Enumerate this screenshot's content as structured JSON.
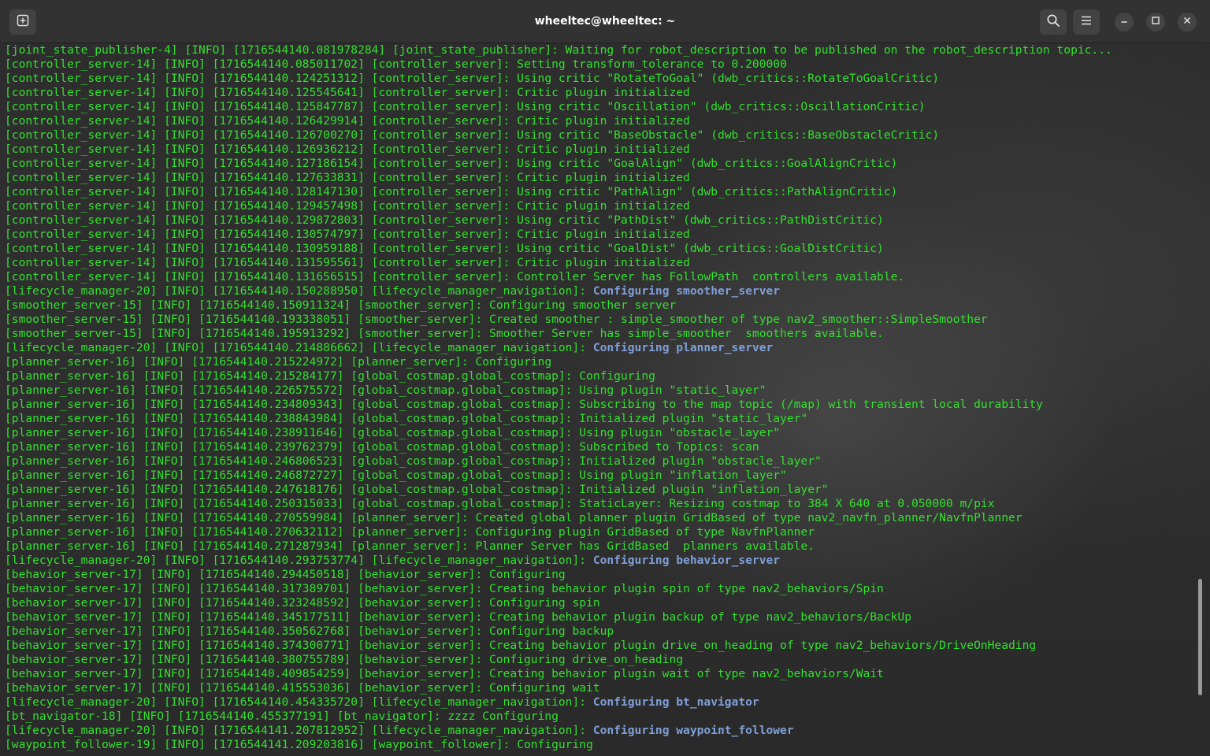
{
  "window": {
    "title": "wheeltec@wheeltec: ~"
  },
  "icons": {
    "new_tab": "new-tab-icon",
    "search": "search-icon",
    "menu": "hamburger-menu-icon",
    "minimize": "minimize-icon",
    "maximize": "maximize-icon",
    "close": "close-icon"
  },
  "colors": {
    "log_text": "#33e02f",
    "highlight_text": "#7f9fd8",
    "titlebar_bg": "#323232",
    "terminal_bg": "#2d2d2d"
  },
  "terminal": {
    "lines": [
      {
        "text": "[joint_state_publisher-4] [INFO] [1716544140.081978284] [joint_state_publisher]: Waiting for robot_description to be published on the robot_description topic..."
      },
      {
        "text": "[controller_server-14] [INFO] [1716544140.085011702] [controller_server]: Setting transform_tolerance to 0.200000"
      },
      {
        "text": "[controller_server-14] [INFO] [1716544140.124251312] [controller_server]: Using critic \"RotateToGoal\" (dwb_critics::RotateToGoalCritic)"
      },
      {
        "text": "[controller_server-14] [INFO] [1716544140.125545641] [controller_server]: Critic plugin initialized"
      },
      {
        "text": "[controller_server-14] [INFO] [1716544140.125847787] [controller_server]: Using critic \"Oscillation\" (dwb_critics::OscillationCritic)"
      },
      {
        "text": "[controller_server-14] [INFO] [1716544140.126429914] [controller_server]: Critic plugin initialized"
      },
      {
        "text": "[controller_server-14] [INFO] [1716544140.126700270] [controller_server]: Using critic \"BaseObstacle\" (dwb_critics::BaseObstacleCritic)"
      },
      {
        "text": "[controller_server-14] [INFO] [1716544140.126936212] [controller_server]: Critic plugin initialized"
      },
      {
        "text": "[controller_server-14] [INFO] [1716544140.127186154] [controller_server]: Using critic \"GoalAlign\" (dwb_critics::GoalAlignCritic)"
      },
      {
        "text": "[controller_server-14] [INFO] [1716544140.127633831] [controller_server]: Critic plugin initialized"
      },
      {
        "text": "[controller_server-14] [INFO] [1716544140.128147130] [controller_server]: Using critic \"PathAlign\" (dwb_critics::PathAlignCritic)"
      },
      {
        "text": "[controller_server-14] [INFO] [1716544140.129457498] [controller_server]: Critic plugin initialized"
      },
      {
        "text": "[controller_server-14] [INFO] [1716544140.129872803] [controller_server]: Using critic \"PathDist\" (dwb_critics::PathDistCritic)"
      },
      {
        "text": "[controller_server-14] [INFO] [1716544140.130574797] [controller_server]: Critic plugin initialized"
      },
      {
        "text": "[controller_server-14] [INFO] [1716544140.130959188] [controller_server]: Using critic \"GoalDist\" (dwb_critics::GoalDistCritic)"
      },
      {
        "text": "[controller_server-14] [INFO] [1716544140.131595561] [controller_server]: Critic plugin initialized"
      },
      {
        "text": "[controller_server-14] [INFO] [1716544140.131656515] [controller_server]: Controller Server has FollowPath  controllers available."
      },
      {
        "text": "[lifecycle_manager-20] [INFO] [1716544140.150288950] [lifecycle_manager_navigation]: ",
        "hl": "Configuring smoother_server"
      },
      {
        "text": "[smoother_server-15] [INFO] [1716544140.150911324] [smoother_server]: Configuring smoother server"
      },
      {
        "text": "[smoother_server-15] [INFO] [1716544140.193338051] [smoother_server]: Created smoother : simple_smoother of type nav2_smoother::SimpleSmoother"
      },
      {
        "text": "[smoother_server-15] [INFO] [1716544140.195913292] [smoother_server]: Smoother Server has simple_smoother  smoothers available."
      },
      {
        "text": "[lifecycle_manager-20] [INFO] [1716544140.214886662] [lifecycle_manager_navigation]: ",
        "hl": "Configuring planner_server"
      },
      {
        "text": "[planner_server-16] [INFO] [1716544140.215224972] [planner_server]: Configuring"
      },
      {
        "text": "[planner_server-16] [INFO] [1716544140.215284177] [global_costmap.global_costmap]: Configuring"
      },
      {
        "text": "[planner_server-16] [INFO] [1716544140.226575572] [global_costmap.global_costmap]: Using plugin \"static_layer\""
      },
      {
        "text": "[planner_server-16] [INFO] [1716544140.234809343] [global_costmap.global_costmap]: Subscribing to the map topic (/map) with transient local durability"
      },
      {
        "text": "[planner_server-16] [INFO] [1716544140.238843984] [global_costmap.global_costmap]: Initialized plugin \"static_layer\""
      },
      {
        "text": "[planner_server-16] [INFO] [1716544140.238911646] [global_costmap.global_costmap]: Using plugin \"obstacle_layer\""
      },
      {
        "text": "[planner_server-16] [INFO] [1716544140.239762379] [global_costmap.global_costmap]: Subscribed to Topics: scan"
      },
      {
        "text": "[planner_server-16] [INFO] [1716544140.246806523] [global_costmap.global_costmap]: Initialized plugin \"obstacle_layer\""
      },
      {
        "text": "[planner_server-16] [INFO] [1716544140.246872727] [global_costmap.global_costmap]: Using plugin \"inflation_layer\""
      },
      {
        "text": "[planner_server-16] [INFO] [1716544140.247618176] [global_costmap.global_costmap]: Initialized plugin \"inflation_layer\""
      },
      {
        "text": "[planner_server-16] [INFO] [1716544140.250315033] [global_costmap.global_costmap]: StaticLayer: Resizing costmap to 384 X 640 at 0.050000 m/pix"
      },
      {
        "text": "[planner_server-16] [INFO] [1716544140.270559984] [planner_server]: Created global planner plugin GridBased of type nav2_navfn_planner/NavfnPlanner"
      },
      {
        "text": "[planner_server-16] [INFO] [1716544140.270632112] [planner_server]: Configuring plugin GridBased of type NavfnPlanner"
      },
      {
        "text": "[planner_server-16] [INFO] [1716544140.271287934] [planner_server]: Planner Server has GridBased  planners available."
      },
      {
        "text": "[lifecycle_manager-20] [INFO] [1716544140.293753774] [lifecycle_manager_navigation]: ",
        "hl": "Configuring behavior_server"
      },
      {
        "text": "[behavior_server-17] [INFO] [1716544140.294450518] [behavior_server]: Configuring"
      },
      {
        "text": "[behavior_server-17] [INFO] [1716544140.317389701] [behavior_server]: Creating behavior plugin spin of type nav2_behaviors/Spin"
      },
      {
        "text": "[behavior_server-17] [INFO] [1716544140.323248592] [behavior_server]: Configuring spin"
      },
      {
        "text": "[behavior_server-17] [INFO] [1716544140.345177511] [behavior_server]: Creating behavior plugin backup of type nav2_behaviors/BackUp"
      },
      {
        "text": "[behavior_server-17] [INFO] [1716544140.350562768] [behavior_server]: Configuring backup"
      },
      {
        "text": "[behavior_server-17] [INFO] [1716544140.374300771] [behavior_server]: Creating behavior plugin drive_on_heading of type nav2_behaviors/DriveOnHeading"
      },
      {
        "text": "[behavior_server-17] [INFO] [1716544140.380755789] [behavior_server]: Configuring drive_on_heading"
      },
      {
        "text": "[behavior_server-17] [INFO] [1716544140.409854259] [behavior_server]: Creating behavior plugin wait of type nav2_behaviors/Wait"
      },
      {
        "text": "[behavior_server-17] [INFO] [1716544140.415553036] [behavior_server]: Configuring wait"
      },
      {
        "text": "[lifecycle_manager-20] [INFO] [1716544140.454335720] [lifecycle_manager_navigation]: ",
        "hl": "Configuring bt_navigator"
      },
      {
        "text": "[bt_navigator-18] [INFO] [1716544140.455377191] [bt_navigator]: zzzz Configuring"
      },
      {
        "text": "[lifecycle_manager-20] [INFO] [1716544141.207812952] [lifecycle_manager_navigation]: ",
        "hl": "Configuring waypoint_follower"
      },
      {
        "text": "[waypoint_follower-19] [INFO] [1716544141.209203816] [waypoint_follower]: Configuring"
      }
    ]
  }
}
